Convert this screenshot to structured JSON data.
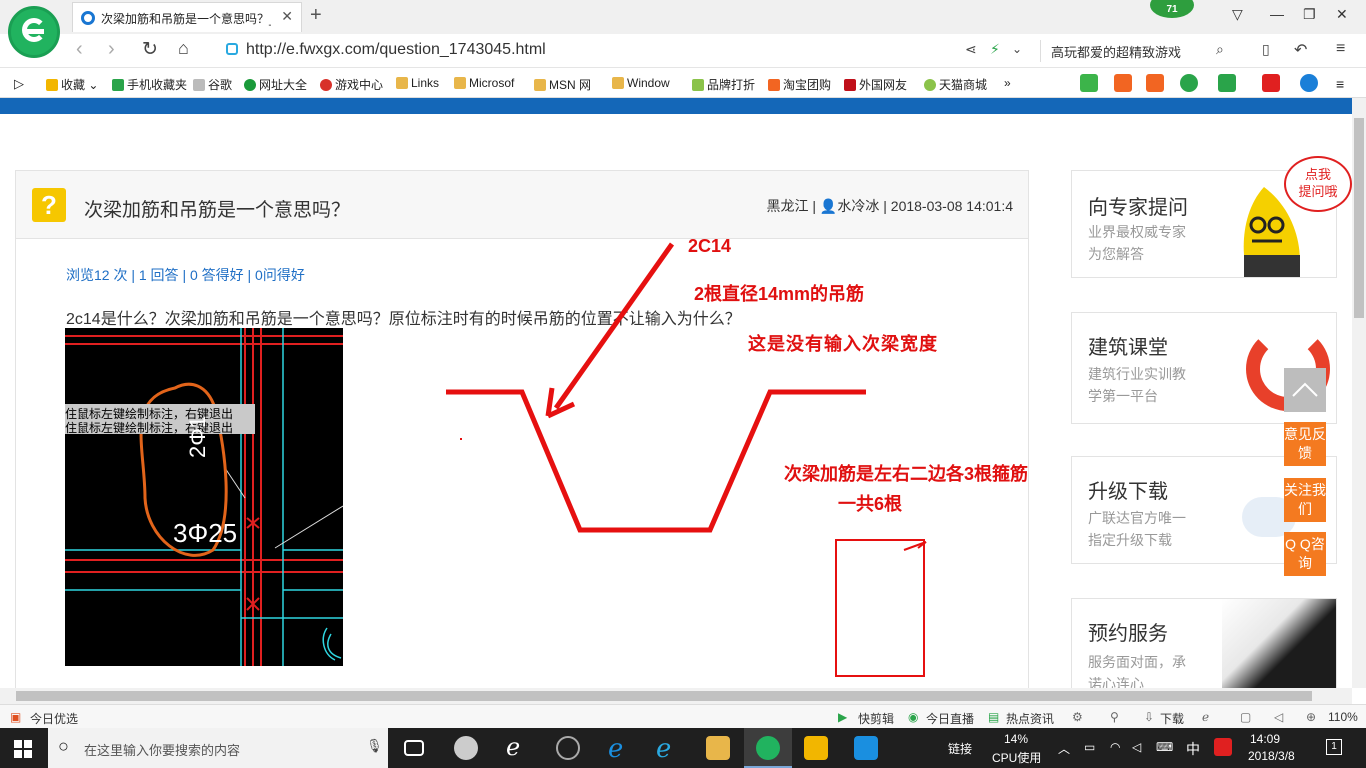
{
  "browser": {
    "tab_title": "次梁加筋和吊筋是一个意思吗？_",
    "tab_close": "✕",
    "new_tab": "+",
    "badge": "71",
    "url": "http://e.fwxgx.com/question_1743045.html",
    "search_placeholder": "高玩都爱的超精致游戏"
  },
  "bookmarks": [
    {
      "label": "收藏",
      "color": "#f2b600"
    },
    {
      "label": "手机收藏夹",
      "color": "#2aa44a"
    },
    {
      "label": "谷歌",
      "color": "#aaaaaa"
    },
    {
      "label": "网址大全",
      "color": "#1a9a3a"
    },
    {
      "label": "游戏中心",
      "color": "#d8312a"
    },
    {
      "label": "Links",
      "color": "#e8b64a"
    },
    {
      "label": "Microsof",
      "color": "#e8b64a"
    },
    {
      "label": "MSN 网",
      "color": "#e8b64a"
    },
    {
      "label": "Window",
      "color": "#e8b64a"
    },
    {
      "label": "品牌打折",
      "color": "#8bc34a"
    },
    {
      "label": "淘宝团购",
      "color": "#f26522"
    },
    {
      "label": "外国网友",
      "color": "#c0101a"
    },
    {
      "label": "天猫商城",
      "color": "#8bc34a"
    }
  ],
  "question": {
    "title": "次梁加筋和吊筋是一个意思吗？",
    "meta": "黑龙江 | 👤水冷冰 | 2018-03-08 14:01:4",
    "stats": "浏览12 次 | 1 回答 | 0 答得好 | 0问得好",
    "body": "2c14是什么？次梁加筋和吊筋是一个意思吗？原位标注时有的时候吊筋的位置不让输入为什么？",
    "cad_prompt_1": "住鼠标左键绘制标注，右键退出",
    "cad_prompt_2": "住鼠标左键绘制标注，右键退出",
    "cad_label_1": "2Φ1",
    "cad_label_2": "3Φ25"
  },
  "annotations": {
    "a1": "2C14",
    "a2": "2根直径14mm的吊筋",
    "a3": "这是没有输入次梁宽度",
    "a4": "次梁加筋是左右二边各3根箍筋",
    "a5": "一共6根"
  },
  "sidebar": {
    "cards": [
      {
        "title": "向专家提问",
        "line1": "业界最权威专家",
        "line2": "为您解答"
      },
      {
        "title": "建筑课堂",
        "line1": "建筑行业实训教",
        "line2": "学第一平台"
      },
      {
        "title": "升级下载",
        "line1": "广联达官方唯一",
        "line2": "指定升级下载"
      },
      {
        "title": "预约服务",
        "line1": "服务面对面，承",
        "line2": "诺心连心"
      }
    ],
    "bubble": "点我\n提问哦",
    "float_buttons": [
      "意见反馈",
      "关注我们",
      "Q Q咨询"
    ]
  },
  "statusbar": {
    "left": "今日优选",
    "items": [
      "快剪辑",
      "今日直播",
      "热点资讯",
      "下载"
    ],
    "zoom": "110%"
  },
  "taskbar": {
    "search_placeholder": "在这里输入你要搜索的内容",
    "link": "链接",
    "cpu_value": "14%",
    "cpu_label": "CPU使用",
    "ime": "中",
    "time": "14:09",
    "date": "2018/3/8",
    "notif": "1"
  },
  "colors": {
    "accent": "#1467b8",
    "annotation": "#e01010",
    "orange": "#f47a20"
  }
}
